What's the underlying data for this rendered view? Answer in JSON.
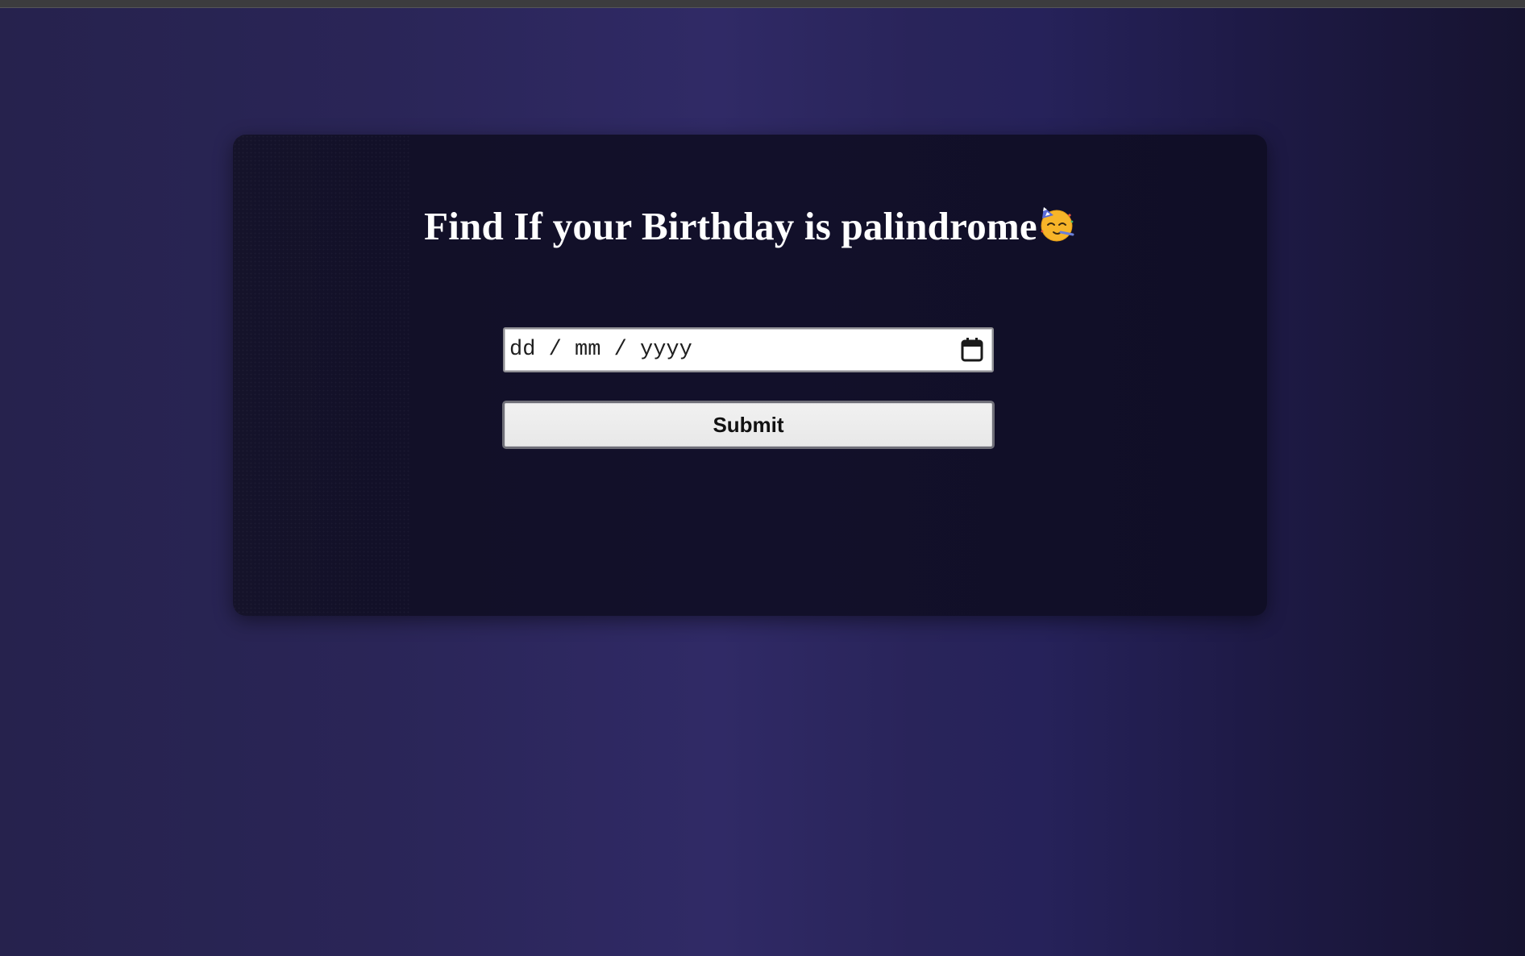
{
  "page": {
    "title": "Find If your Birthday is palindrome",
    "title_icon": "partying-face-icon"
  },
  "form": {
    "date_input": {
      "placeholder": "dd / mm / yyyy",
      "value": "",
      "icon": "calendar-icon"
    },
    "submit_label": "Submit"
  },
  "colors": {
    "background_accent": "#302a66",
    "card": "#12102a",
    "title_text": "#ffffff",
    "button_bg": "#eeeeee",
    "button_text": "#111111",
    "emoji_face": "#f7b529"
  }
}
